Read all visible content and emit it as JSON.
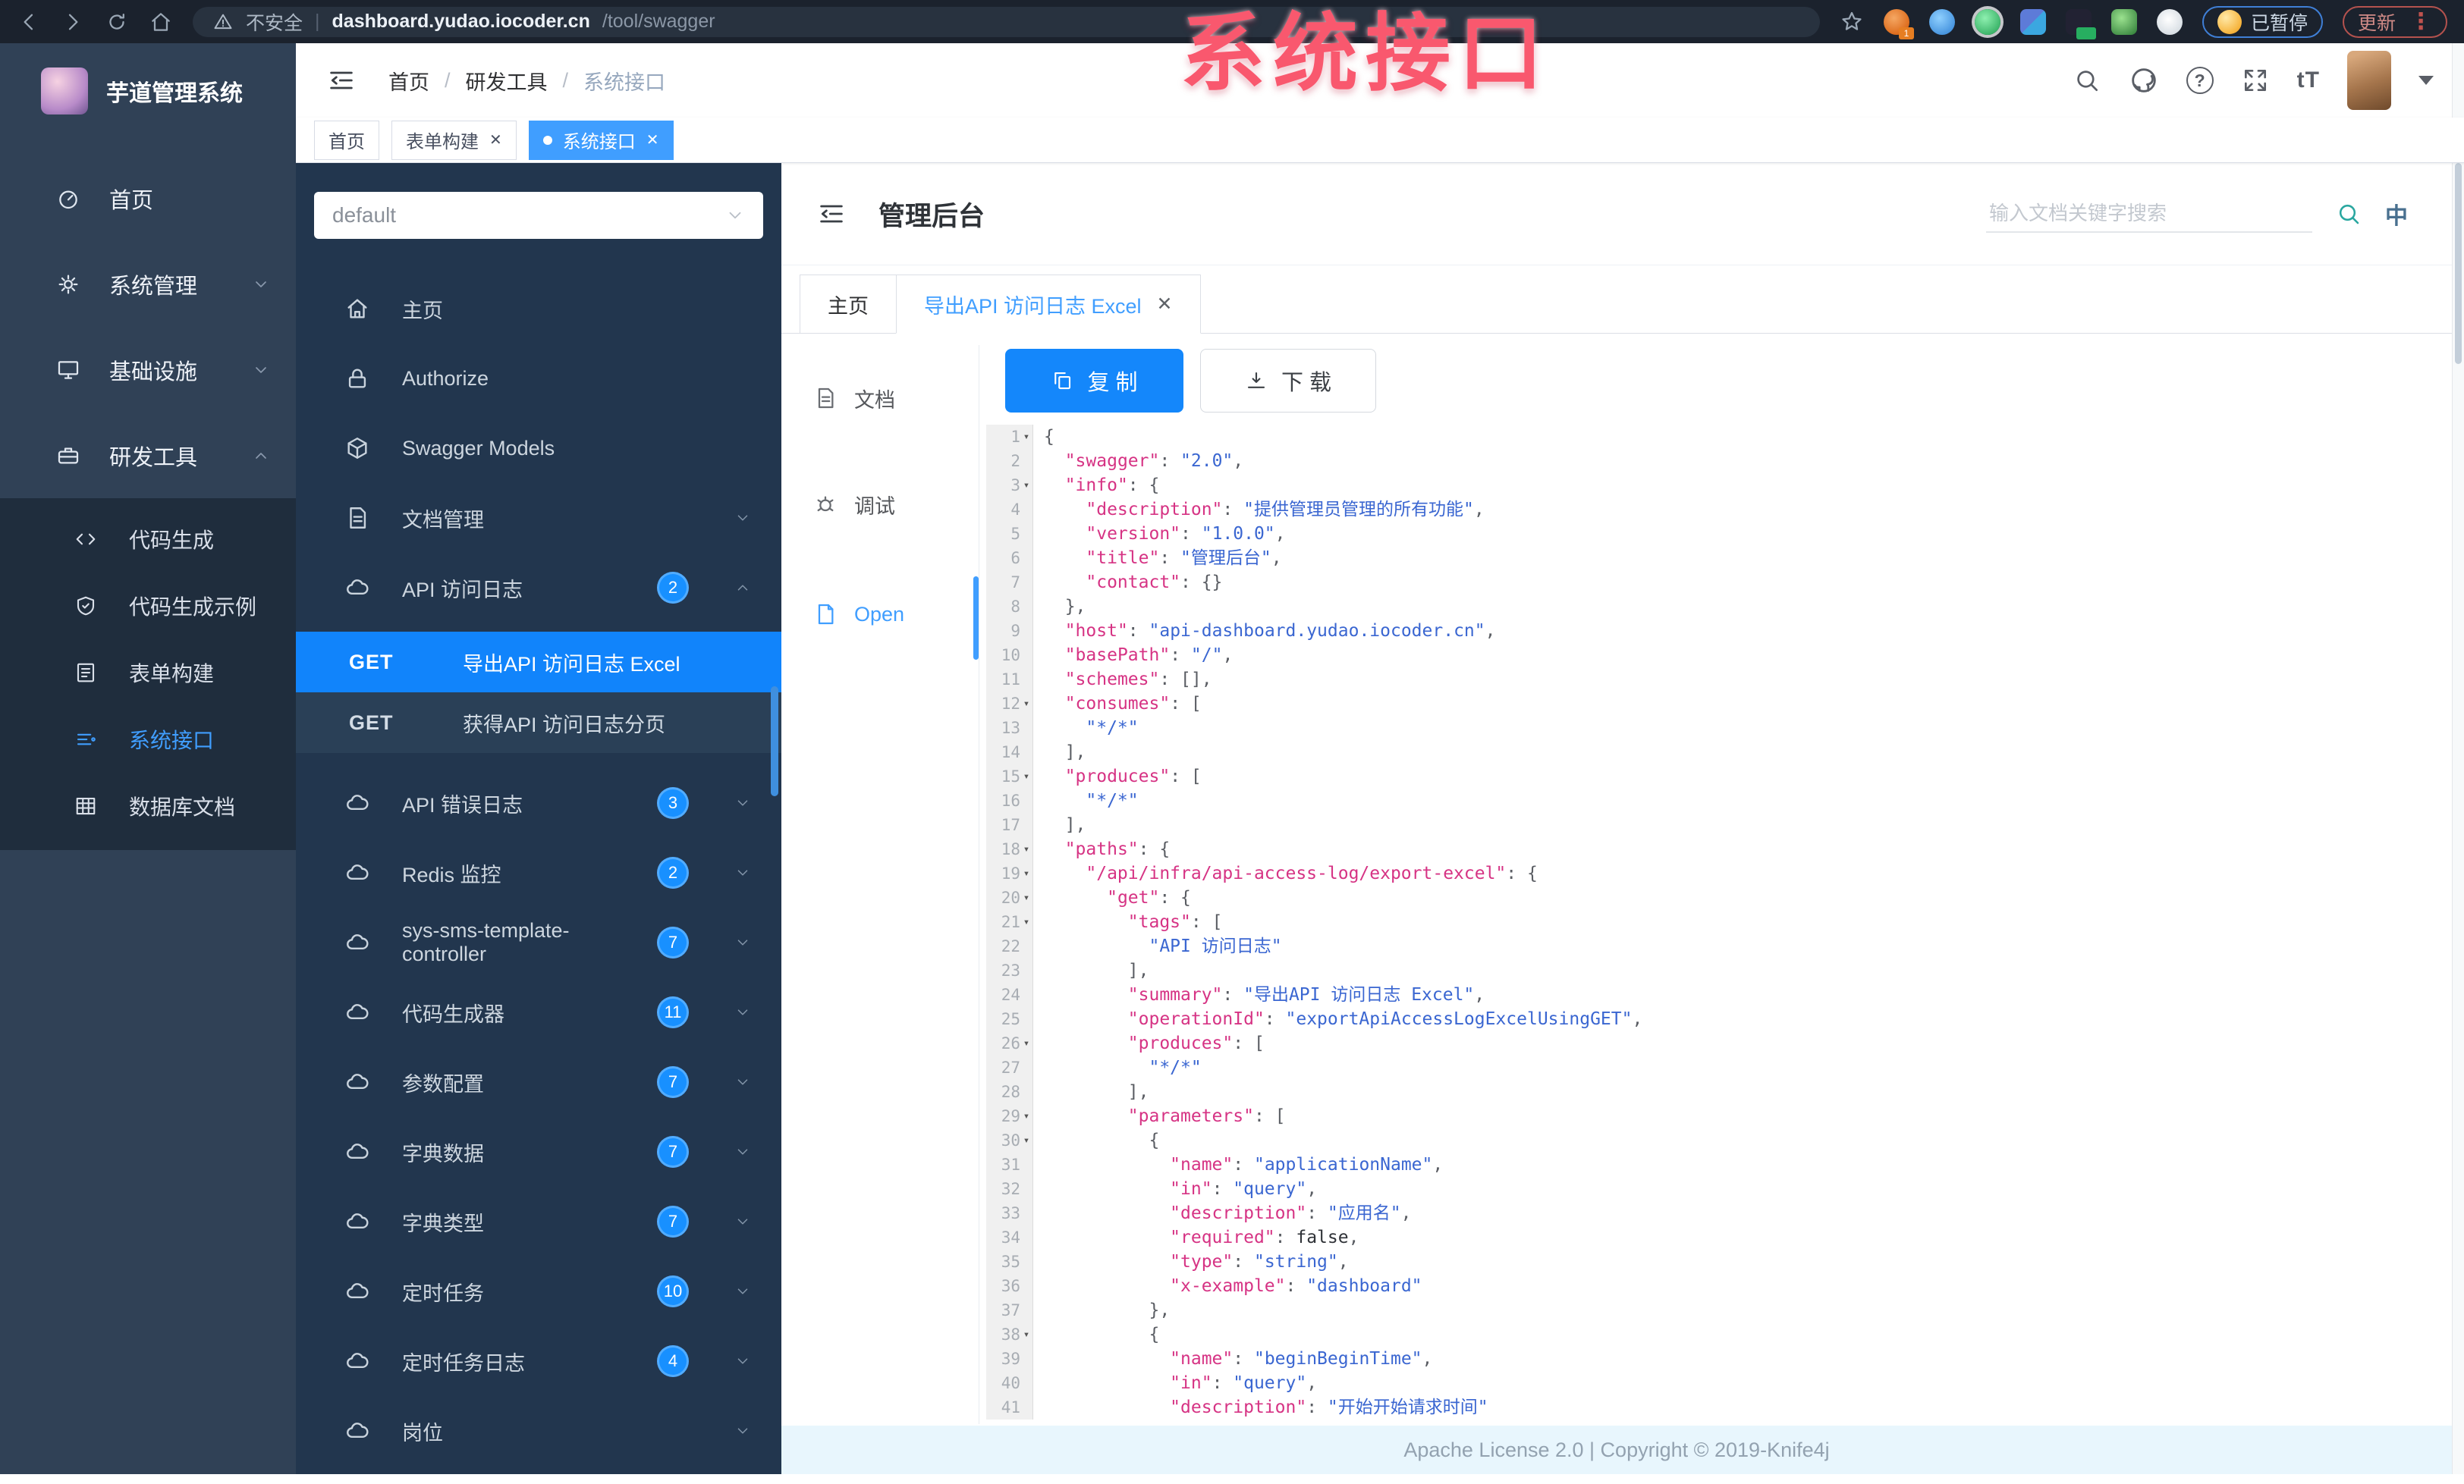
{
  "browser": {
    "security_label": "不安全",
    "url_host": "dashboard.yudao.iocoder.cn",
    "url_path": "/tool/swagger",
    "extension_badge": "1",
    "paused_button": "已暂停",
    "update_button": "更新"
  },
  "watermark": "系统接口",
  "app_sidebar": {
    "logo_title": "芋道管理系统",
    "menu": [
      {
        "label": "首页",
        "icon": "dashboard-icon",
        "chevron": ""
      },
      {
        "label": "系统管理",
        "icon": "gear-icon",
        "chevron": "down"
      },
      {
        "label": "基础设施",
        "icon": "infra-icon",
        "chevron": "down"
      },
      {
        "label": "研发工具",
        "icon": "toolbox-icon",
        "chevron": "up"
      }
    ],
    "submenu": [
      {
        "label": "代码生成",
        "icon": "code-icon",
        "active": false
      },
      {
        "label": "代码生成示例",
        "icon": "shield-icon",
        "active": false
      },
      {
        "label": "表单构建",
        "icon": "form-icon",
        "active": false
      },
      {
        "label": "系统接口",
        "icon": "api-icon",
        "active": true
      },
      {
        "label": "数据库文档",
        "icon": "table-icon",
        "active": false
      }
    ]
  },
  "header": {
    "breadcrumb": [
      "首页",
      "研发工具",
      "系统接口"
    ]
  },
  "tags": [
    {
      "label": "首页",
      "closable": false,
      "active": false
    },
    {
      "label": "表单构建",
      "closable": true,
      "active": false
    },
    {
      "label": "系统接口",
      "closable": true,
      "active": true
    }
  ],
  "swagger_panel": {
    "group_select": "default",
    "menu_top": [
      {
        "label": "主页",
        "icon": "home-icon",
        "badge": "",
        "chevron": ""
      },
      {
        "label": "Authorize",
        "icon": "lock-icon",
        "badge": "",
        "chevron": ""
      },
      {
        "label": "Swagger Models",
        "icon": "cube-icon",
        "badge": "",
        "chevron": ""
      },
      {
        "label": "文档管理",
        "icon": "doc-icon",
        "badge": "",
        "chevron": "down"
      },
      {
        "label": "API 访问日志",
        "icon": "cloud-icon",
        "badge": "2",
        "chevron": "up"
      }
    ],
    "operations": [
      {
        "method": "GET",
        "label": "导出API 访问日志 Excel",
        "active": true
      },
      {
        "method": "GET",
        "label": "获得API 访问日志分页",
        "active": false
      }
    ],
    "menu_bottom": [
      {
        "label": "API 错误日志",
        "icon": "cloud-icon",
        "badge": "3",
        "chevron": "down"
      },
      {
        "label": "Redis 监控",
        "icon": "cloud-icon",
        "badge": "2",
        "chevron": "down"
      },
      {
        "label": "sys-sms-template-controller",
        "icon": "cloud-icon",
        "badge": "7",
        "chevron": "down"
      },
      {
        "label": "代码生成器",
        "icon": "cloud-icon",
        "badge": "11",
        "chevron": "down"
      },
      {
        "label": "参数配置",
        "icon": "cloud-icon",
        "badge": "7",
        "chevron": "down"
      },
      {
        "label": "字典数据",
        "icon": "cloud-icon",
        "badge": "7",
        "chevron": "down"
      },
      {
        "label": "字典类型",
        "icon": "cloud-icon",
        "badge": "7",
        "chevron": "down"
      },
      {
        "label": "定时任务",
        "icon": "cloud-icon",
        "badge": "10",
        "chevron": "down"
      },
      {
        "label": "定时任务日志",
        "icon": "cloud-icon",
        "badge": "4",
        "chevron": "down"
      },
      {
        "label": "岗位",
        "icon": "cloud-icon",
        "badge": "",
        "chevron": "down"
      }
    ]
  },
  "doc": {
    "title": "管理后台",
    "search_placeholder": "输入文档关键字搜索",
    "lang_label": "中",
    "tabs": [
      {
        "label": "主页",
        "active": false,
        "closable": false
      },
      {
        "label": "导出API 访问日志 Excel",
        "active": true,
        "closable": true
      }
    ],
    "side_tabs": [
      {
        "label": "文档",
        "icon": "doc-icon",
        "active": false
      },
      {
        "label": "调试",
        "icon": "debug-icon",
        "active": false
      },
      {
        "label": "Open",
        "icon": "file-icon",
        "active": true
      }
    ],
    "copy_button": "复 制",
    "download_button": "下 载",
    "footer_text": "Apache License 2.0 | Copyright © 2019-Knife4j"
  },
  "code": {
    "lines": [
      "{",
      "  \"swagger\": \"2.0\",",
      "  \"info\": {",
      "    \"description\": \"提供管理员管理的所有功能\",",
      "    \"version\": \"1.0.0\",",
      "    \"title\": \"管理后台\",",
      "    \"contact\": {}",
      "  },",
      "  \"host\": \"api-dashboard.yudao.iocoder.cn\",",
      "  \"basePath\": \"/\",",
      "  \"schemes\": [],",
      "  \"consumes\": [",
      "    \"*/*\"",
      "  ],",
      "  \"produces\": [",
      "    \"*/*\"",
      "  ],",
      "  \"paths\": {",
      "    \"/api/infra/api-access-log/export-excel\": {",
      "      \"get\": {",
      "        \"tags\": [",
      "          \"API 访问日志\"",
      "        ],",
      "        \"summary\": \"导出API 访问日志 Excel\",",
      "        \"operationId\": \"exportApiAccessLogExcelUsingGET\",",
      "        \"produces\": [",
      "          \"*/*\"",
      "        ],",
      "        \"parameters\": [",
      "          {",
      "            \"name\": \"applicationName\",",
      "            \"in\": \"query\",",
      "            \"description\": \"应用名\",",
      "            \"required\": false,",
      "            \"type\": \"string\",",
      "            \"x-example\": \"dashboard\"",
      "          },",
      "          {",
      "            \"name\": \"beginBeginTime\",",
      "            \"in\": \"query\",",
      "            \"description\": \"开始开始请求时间\""
    ],
    "fold_lines": [
      1,
      3,
      12,
      15,
      18,
      19,
      20,
      21,
      26,
      29,
      30,
      38
    ]
  }
}
